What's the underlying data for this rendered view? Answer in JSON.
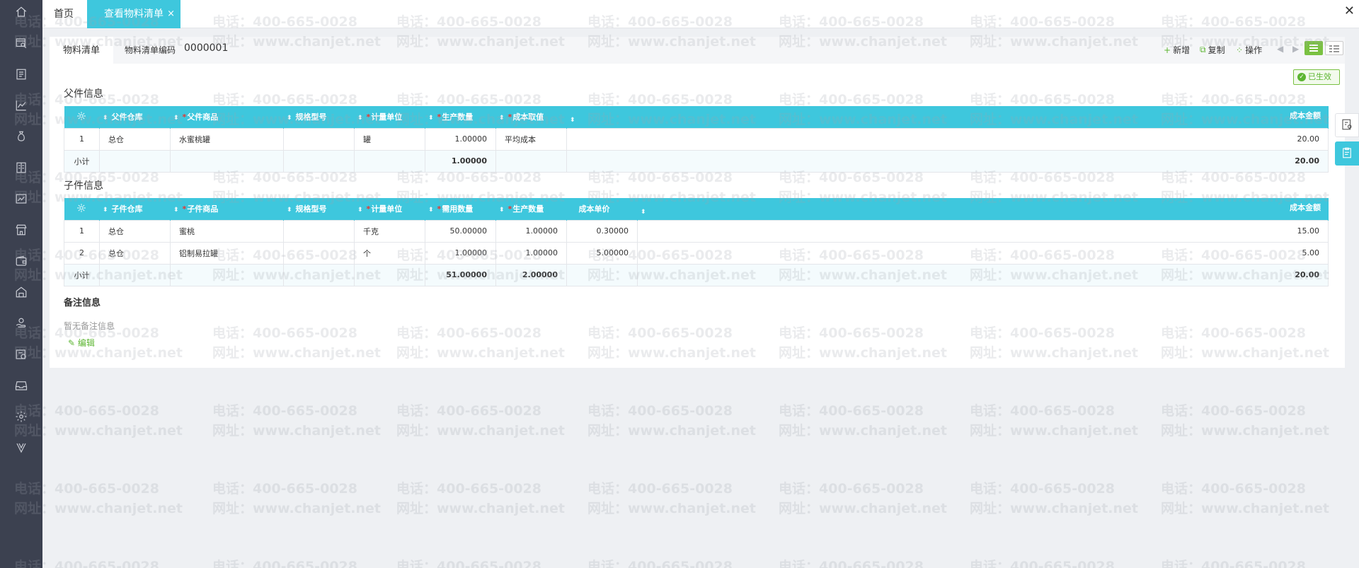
{
  "sidebar": {
    "icons": [
      "home-icon",
      "search-doc-icon",
      "doc-icon",
      "chart-icon",
      "money-bag-icon",
      "ledger-icon",
      "report-icon",
      "store-icon",
      "wallet-icon",
      "warehouse-icon",
      "hand-coin-icon",
      "card-icon",
      "inbox-icon",
      "settings-icon",
      "v-logo-icon"
    ]
  },
  "tabs": {
    "home": "首页",
    "active": "查看物料清单",
    "close_glyph": "×"
  },
  "window": {
    "close_glyph": "✕"
  },
  "form": {
    "tab_label": "物料清单",
    "code_label": "物料清单编码",
    "code_value": "0000001",
    "status": "已生效"
  },
  "toolbar": {
    "new_label": "新增",
    "copy_label": "复制",
    "ops_label": "操作"
  },
  "parent": {
    "title": "父件信息",
    "headers": {
      "warehouse": "父件仓库",
      "product": "父件商品",
      "spec": "规格型号",
      "unit": "计量单位",
      "qty": "生产数量",
      "cost_method": "成本取值",
      "cost_amount": "成本金额"
    },
    "rows": [
      {
        "no": "1",
        "warehouse": "总仓",
        "product": "水蜜桃罐",
        "spec": "",
        "unit": "罐",
        "qty": "1.00000",
        "cost_method": "平均成本",
        "cost_amount": "20.00"
      }
    ],
    "subtotal": {
      "label": "小计",
      "qty": "1.00000",
      "cost_amount": "20.00"
    }
  },
  "child": {
    "title": "子件信息",
    "headers": {
      "warehouse": "子件仓库",
      "product": "子件商品",
      "spec": "规格型号",
      "unit": "计量单位",
      "use_qty": "需用数量",
      "prod_qty": "生产数量",
      "unit_cost": "成本单价",
      "cost_amount": "成本金额"
    },
    "rows": [
      {
        "no": "1",
        "warehouse": "总仓",
        "product": "蜜桃",
        "spec": "",
        "unit": "千克",
        "use_qty": "50.00000",
        "prod_qty": "1.00000",
        "unit_cost": "0.30000",
        "cost_amount": "15.00"
      },
      {
        "no": "2",
        "warehouse": "总仓",
        "product": "铝制易拉罐",
        "spec": "",
        "unit": "个",
        "use_qty": "1.00000",
        "prod_qty": "1.00000",
        "unit_cost": "5.00000",
        "cost_amount": "5.00"
      }
    ],
    "subtotal": {
      "label": "小计",
      "use_qty": "51.00000",
      "prod_qty": "2.00000",
      "cost_amount": "20.00"
    }
  },
  "remark": {
    "title": "备注信息",
    "empty_text": "暂无备注信息",
    "edit_label": "编辑"
  },
  "watermark": {
    "phone": "电话：400-665-0028",
    "site": "网址：www.chanjet.net"
  },
  "colors": {
    "sidebar": "#3c4150",
    "accent": "#3ec7dd",
    "success": "#5cb531",
    "required": "#e53935"
  }
}
